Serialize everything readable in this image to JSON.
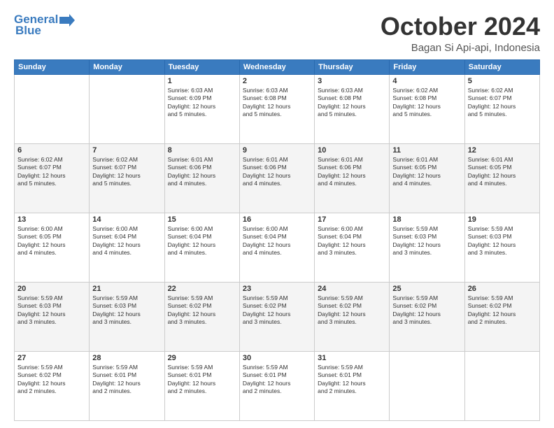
{
  "logo": {
    "line1": "General",
    "line2": "Blue"
  },
  "title": "October 2024",
  "location": "Bagan Si Api-api, Indonesia",
  "days_of_week": [
    "Sunday",
    "Monday",
    "Tuesday",
    "Wednesday",
    "Thursday",
    "Friday",
    "Saturday"
  ],
  "weeks": [
    [
      {
        "day": "",
        "info": ""
      },
      {
        "day": "",
        "info": ""
      },
      {
        "day": "1",
        "info": "Sunrise: 6:03 AM\nSunset: 6:09 PM\nDaylight: 12 hours\nand 5 minutes."
      },
      {
        "day": "2",
        "info": "Sunrise: 6:03 AM\nSunset: 6:08 PM\nDaylight: 12 hours\nand 5 minutes."
      },
      {
        "day": "3",
        "info": "Sunrise: 6:03 AM\nSunset: 6:08 PM\nDaylight: 12 hours\nand 5 minutes."
      },
      {
        "day": "4",
        "info": "Sunrise: 6:02 AM\nSunset: 6:08 PM\nDaylight: 12 hours\nand 5 minutes."
      },
      {
        "day": "5",
        "info": "Sunrise: 6:02 AM\nSunset: 6:07 PM\nDaylight: 12 hours\nand 5 minutes."
      }
    ],
    [
      {
        "day": "6",
        "info": "Sunrise: 6:02 AM\nSunset: 6:07 PM\nDaylight: 12 hours\nand 5 minutes."
      },
      {
        "day": "7",
        "info": "Sunrise: 6:02 AM\nSunset: 6:07 PM\nDaylight: 12 hours\nand 5 minutes."
      },
      {
        "day": "8",
        "info": "Sunrise: 6:01 AM\nSunset: 6:06 PM\nDaylight: 12 hours\nand 4 minutes."
      },
      {
        "day": "9",
        "info": "Sunrise: 6:01 AM\nSunset: 6:06 PM\nDaylight: 12 hours\nand 4 minutes."
      },
      {
        "day": "10",
        "info": "Sunrise: 6:01 AM\nSunset: 6:06 PM\nDaylight: 12 hours\nand 4 minutes."
      },
      {
        "day": "11",
        "info": "Sunrise: 6:01 AM\nSunset: 6:05 PM\nDaylight: 12 hours\nand 4 minutes."
      },
      {
        "day": "12",
        "info": "Sunrise: 6:01 AM\nSunset: 6:05 PM\nDaylight: 12 hours\nand 4 minutes."
      }
    ],
    [
      {
        "day": "13",
        "info": "Sunrise: 6:00 AM\nSunset: 6:05 PM\nDaylight: 12 hours\nand 4 minutes."
      },
      {
        "day": "14",
        "info": "Sunrise: 6:00 AM\nSunset: 6:04 PM\nDaylight: 12 hours\nand 4 minutes."
      },
      {
        "day": "15",
        "info": "Sunrise: 6:00 AM\nSunset: 6:04 PM\nDaylight: 12 hours\nand 4 minutes."
      },
      {
        "day": "16",
        "info": "Sunrise: 6:00 AM\nSunset: 6:04 PM\nDaylight: 12 hours\nand 4 minutes."
      },
      {
        "day": "17",
        "info": "Sunrise: 6:00 AM\nSunset: 6:04 PM\nDaylight: 12 hours\nand 3 minutes."
      },
      {
        "day": "18",
        "info": "Sunrise: 5:59 AM\nSunset: 6:03 PM\nDaylight: 12 hours\nand 3 minutes."
      },
      {
        "day": "19",
        "info": "Sunrise: 5:59 AM\nSunset: 6:03 PM\nDaylight: 12 hours\nand 3 minutes."
      }
    ],
    [
      {
        "day": "20",
        "info": "Sunrise: 5:59 AM\nSunset: 6:03 PM\nDaylight: 12 hours\nand 3 minutes."
      },
      {
        "day": "21",
        "info": "Sunrise: 5:59 AM\nSunset: 6:03 PM\nDaylight: 12 hours\nand 3 minutes."
      },
      {
        "day": "22",
        "info": "Sunrise: 5:59 AM\nSunset: 6:02 PM\nDaylight: 12 hours\nand 3 minutes."
      },
      {
        "day": "23",
        "info": "Sunrise: 5:59 AM\nSunset: 6:02 PM\nDaylight: 12 hours\nand 3 minutes."
      },
      {
        "day": "24",
        "info": "Sunrise: 5:59 AM\nSunset: 6:02 PM\nDaylight: 12 hours\nand 3 minutes."
      },
      {
        "day": "25",
        "info": "Sunrise: 5:59 AM\nSunset: 6:02 PM\nDaylight: 12 hours\nand 3 minutes."
      },
      {
        "day": "26",
        "info": "Sunrise: 5:59 AM\nSunset: 6:02 PM\nDaylight: 12 hours\nand 2 minutes."
      }
    ],
    [
      {
        "day": "27",
        "info": "Sunrise: 5:59 AM\nSunset: 6:02 PM\nDaylight: 12 hours\nand 2 minutes."
      },
      {
        "day": "28",
        "info": "Sunrise: 5:59 AM\nSunset: 6:01 PM\nDaylight: 12 hours\nand 2 minutes."
      },
      {
        "day": "29",
        "info": "Sunrise: 5:59 AM\nSunset: 6:01 PM\nDaylight: 12 hours\nand 2 minutes."
      },
      {
        "day": "30",
        "info": "Sunrise: 5:59 AM\nSunset: 6:01 PM\nDaylight: 12 hours\nand 2 minutes."
      },
      {
        "day": "31",
        "info": "Sunrise: 5:59 AM\nSunset: 6:01 PM\nDaylight: 12 hours\nand 2 minutes."
      },
      {
        "day": "",
        "info": ""
      },
      {
        "day": "",
        "info": ""
      }
    ]
  ]
}
